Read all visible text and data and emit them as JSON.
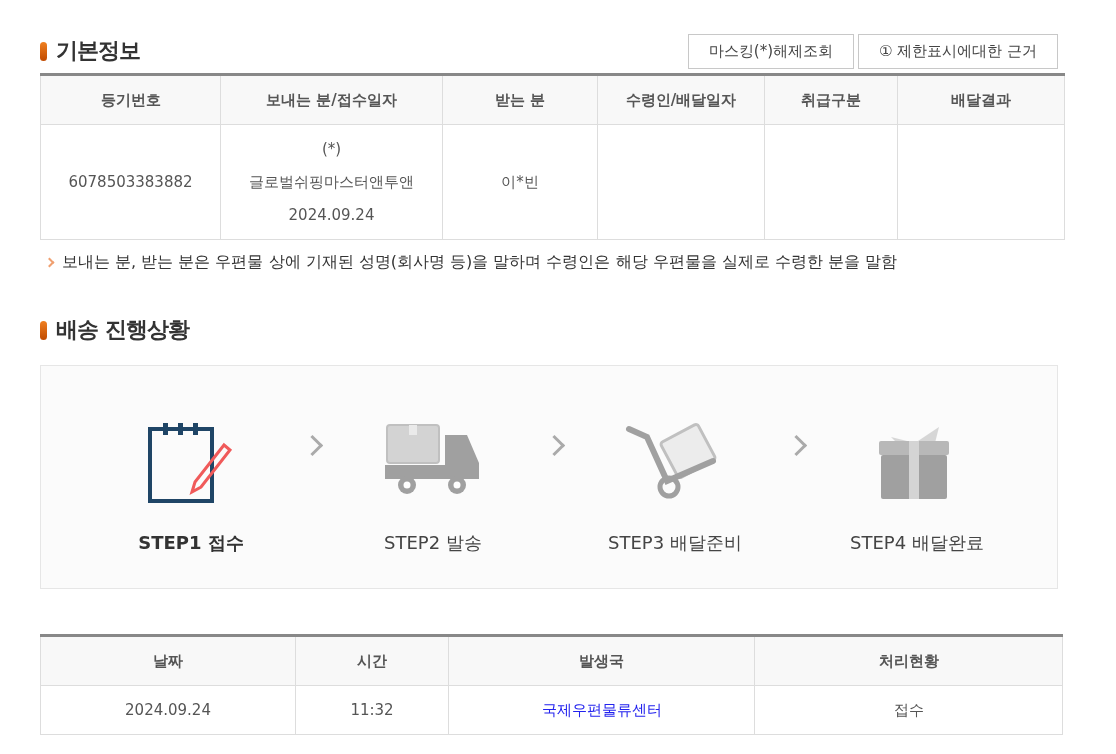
{
  "basic_info": {
    "title": "기본정보",
    "buttons": [
      {
        "label": "마스킹(*)해제조회"
      },
      {
        "label": "① 제한표시에대한 근거"
      }
    ],
    "table": {
      "columns": [
        "등기번호",
        "보내는 분/접수일자",
        "받는 분",
        "수령인/배달일자",
        "취급구분",
        "배달결과"
      ],
      "rows": [
        [
          [
            "6078503383882"
          ],
          [
            "(*)",
            "글로벌쉬핑마스터앤투앤",
            "2024.09.24"
          ],
          [
            "이*빈"
          ],
          [],
          [],
          []
        ]
      ]
    },
    "note": "보내는 분, 받는 분은 우편물 상에 기재된 성명(회사명 등)을 말하며 수령인은 해당 우편물을 실제로 수령한 분을 말함"
  },
  "progress": {
    "title": "배송 진행상황",
    "steps": [
      {
        "kind": "notepad",
        "label": "STEP1 접수",
        "selected": true
      },
      {
        "kind": "truck",
        "label": "STEP2 발송",
        "selected": false
      },
      {
        "kind": "cart",
        "label": "STEP3 배달준비",
        "selected": false
      },
      {
        "kind": "gift",
        "label": "STEP4 배달완료",
        "selected": false
      }
    ]
  },
  "history": {
    "columns": [
      "날짜",
      "시간",
      "발생국",
      "처리현황"
    ],
    "rows": [
      [
        {
          "kind": "text",
          "text": "2024.09.24"
        },
        {
          "kind": "text",
          "text": "11:32"
        },
        {
          "kind": "link",
          "text": "국제우편물류센터"
        },
        {
          "kind": "text",
          "text": "접수"
        }
      ]
    ]
  }
}
